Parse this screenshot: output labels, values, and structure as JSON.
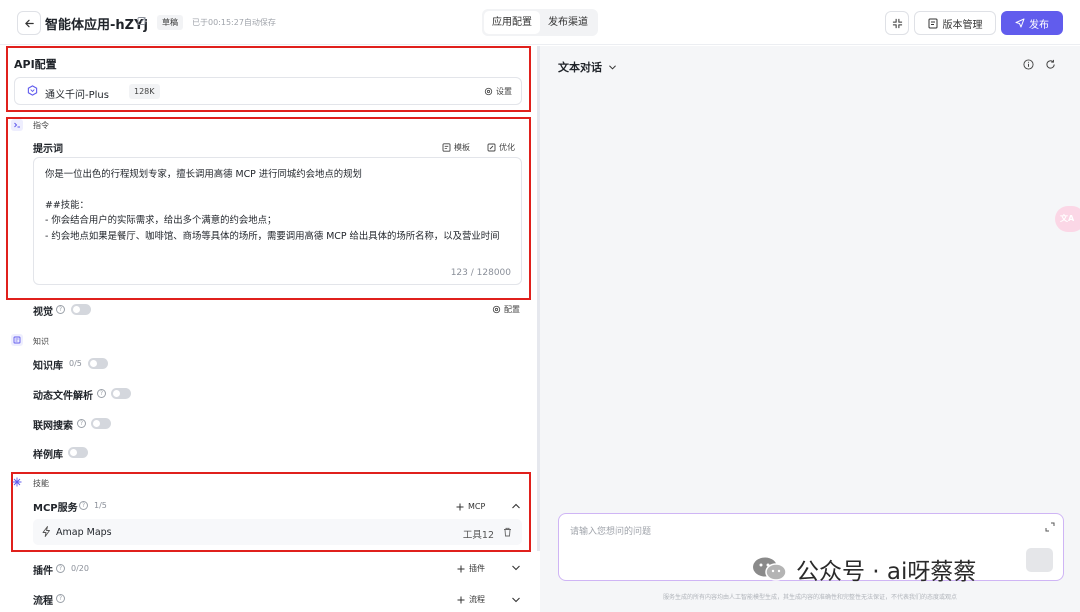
{
  "header": {
    "title": "智能体应用-hZYj",
    "draft_badge": "草稿",
    "autosave": "已于00:15:27自动保存",
    "tabs": [
      {
        "label": "应用配置",
        "active": true
      },
      {
        "label": "发布渠道",
        "active": false
      }
    ],
    "version_button": "版本管理",
    "publish_button": "发布"
  },
  "api_config": {
    "title": "API配置",
    "model_name": "通义千问-Plus",
    "model_context": "128K",
    "settings_label": "设置"
  },
  "instruction": {
    "group_label": "指令",
    "prompt_title": "提示词",
    "template_label": "模板",
    "optimize_label": "优化",
    "prompt_text": "你是一位出色的行程规划专家，擅长调用高德 MCP 进行同城约会地点的规划\n\n##技能：\n- 你会结合用户的实际需求，给出多个满意的约会地点；\n- 约会地点如果是餐厅、咖啡馆、商场等具体的场所，需要调用高德 MCP 给出具体的场所名称，以及营业时间",
    "char_count": "123 / 128000",
    "vision_label": "视觉",
    "config_label": "配置"
  },
  "knowledge": {
    "group_label": "知识",
    "kb_label": "知识库",
    "kb_count": "0/5",
    "dynamic_file_label": "动态文件解析",
    "web_search_label": "联网搜索",
    "sample_lib_label": "样例库"
  },
  "skills": {
    "group_label": "技能",
    "mcp_label": "MCP服务",
    "mcp_count": "1/5",
    "add_mcp_label": "MCP",
    "mcp_items": [
      {
        "name": "Amap Maps",
        "tools": "工具12"
      }
    ],
    "plugin_label": "插件",
    "plugin_count": "0/20",
    "add_plugin_label": "插件",
    "flow_label": "流程",
    "add_flow_label": "流程"
  },
  "chat": {
    "mode_label": "文本对话",
    "input_placeholder": "请输入您想问的问题",
    "disclaimer": "服务生成的所有内容均由人工智能模型生成，其生成内容的准确性和完整性无法保证，不代表我们的态度或观点"
  },
  "translate_fab": "文A",
  "watermark": "公众号 · ai呀蔡蔡",
  "colors": {
    "accent": "#615ced",
    "highlight_border": "#e0201c",
    "input_border": "#cfb5f5"
  }
}
